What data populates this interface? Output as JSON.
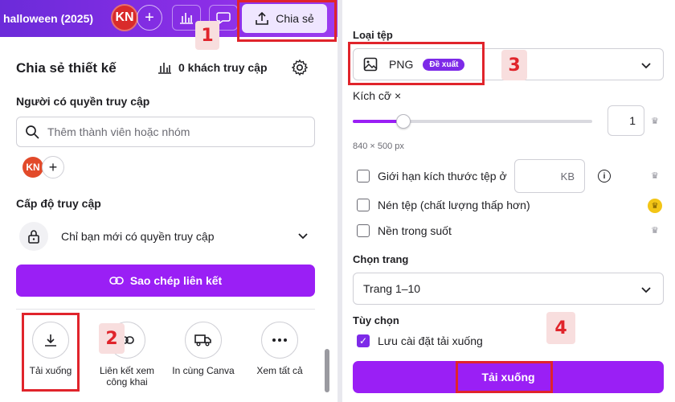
{
  "topbar": {
    "doc_title": "halloween (2025)",
    "avatar_initials": "KN",
    "add_symbol": "+",
    "share_label": "Chia sẻ"
  },
  "share_panel": {
    "title": "Chia sẻ thiết kế",
    "visitors_label": "0 khách truy cập",
    "people_label": "Người có quyền truy cập",
    "search_placeholder": "Thêm thành viên hoặc nhóm",
    "member_initials": "KN",
    "access_level_label": "Cấp độ truy cập",
    "access_value": "Chỉ bạn mới có quyền truy cập",
    "copy_link_label": "Sao chép liên kết",
    "options": [
      {
        "label": "Tải xuống",
        "icon": "download-icon"
      },
      {
        "label": "Liên kết xem công khai",
        "icon": "link-icon"
      },
      {
        "label": "In cùng Canva",
        "icon": "truck-icon"
      },
      {
        "label": "Xem tất cả",
        "icon": "more-icon"
      }
    ]
  },
  "download_panel": {
    "file_type_label": "Loại tệp",
    "file_type_value": "PNG",
    "recommended_badge": "Đề xuất",
    "size_label": "Kích cỡ ×",
    "size_value": "1",
    "size_fraction": 0.21,
    "dimensions": "840 × 500 px",
    "limit_size_label": "Giới hạn kích thước tệp ở",
    "kb_unit": "KB",
    "compress_label": "Nén tệp (chất lượng thấp hơn)",
    "transparent_label": "Nền trong suốt",
    "page_select_label": "Chọn trang",
    "page_select_value": "Trang 1–10",
    "options_label": "Tùy chọn",
    "save_settings_label": "Lưu cài đặt tải xuống",
    "save_settings_checked": true,
    "download_button_label": "Tải xuống"
  },
  "annotations": {
    "step1": "1",
    "step2": "2",
    "step3": "3",
    "step4": "4"
  },
  "colors": {
    "brand_purple": "#9a1ff5",
    "topbar_gradient_start": "#6b2bd9",
    "annotation_red": "#e0242b"
  }
}
